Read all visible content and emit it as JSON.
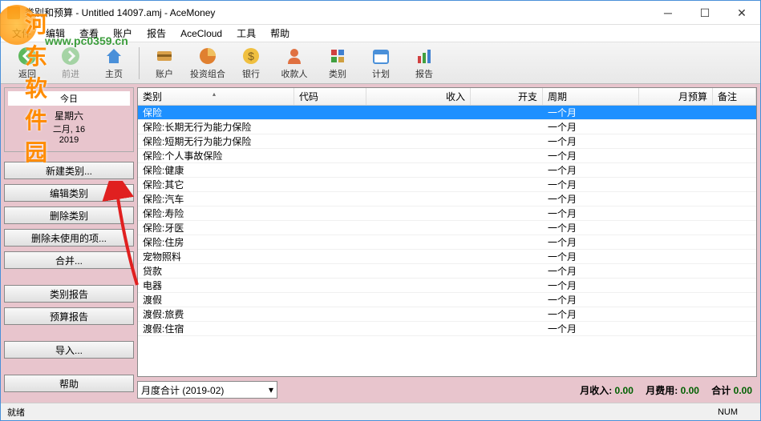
{
  "title": "类别和预算 - Untitled 14097.amj - AceMoney",
  "watermark": {
    "name": "河东软件园",
    "url": "www.pc0359.cn"
  },
  "menu": [
    "文件",
    "编辑",
    "查看",
    "账户",
    "报告",
    "AceCloud",
    "工具",
    "帮助"
  ],
  "toolbar": [
    {
      "label": "返回",
      "icon": "back"
    },
    {
      "label": "前进",
      "icon": "forward",
      "disabled": true
    },
    {
      "label": "主页",
      "icon": "home"
    },
    {
      "sep": true
    },
    {
      "label": "账户",
      "icon": "accounts"
    },
    {
      "label": "投资组合",
      "icon": "portfolio"
    },
    {
      "label": "银行",
      "icon": "bank"
    },
    {
      "label": "收款人",
      "icon": "payee"
    },
    {
      "label": "类别",
      "icon": "category"
    },
    {
      "label": "计划",
      "icon": "schedule"
    },
    {
      "label": "报告",
      "icon": "report"
    }
  ],
  "date": {
    "header": "今日",
    "day": "星期六",
    "month": "二月, 16",
    "year": "2019"
  },
  "sidebar_buttons": [
    "新建类别...",
    "编辑类别",
    "删除类别",
    "删除未使用的项...",
    "合并...",
    "",
    "类别报告",
    "预算报告",
    "",
    "导入...",
    "",
    "帮助"
  ],
  "columns": [
    {
      "label": "类别",
      "cls": "c-cat",
      "sort": true
    },
    {
      "label": "代码",
      "cls": "c-code"
    },
    {
      "label": "收入",
      "cls": "c-income",
      "right": true
    },
    {
      "label": "开支",
      "cls": "c-expense",
      "right": true
    },
    {
      "label": "周期",
      "cls": "c-period"
    },
    {
      "label": "月预算",
      "cls": "c-budget",
      "right": true
    },
    {
      "label": "备注",
      "cls": "c-note"
    }
  ],
  "rows": [
    {
      "cat": "保险",
      "period": "一个月",
      "selected": true
    },
    {
      "cat": "保险:长期无行为能力保险",
      "period": "一个月"
    },
    {
      "cat": "保险:短期无行为能力保险",
      "period": "一个月"
    },
    {
      "cat": "保险:个人事故保险",
      "period": "一个月"
    },
    {
      "cat": "保险:健康",
      "period": "一个月"
    },
    {
      "cat": "保险:其它",
      "period": "一个月"
    },
    {
      "cat": "保险:汽车",
      "period": "一个月"
    },
    {
      "cat": "保险:寿险",
      "period": "一个月"
    },
    {
      "cat": "保险:牙医",
      "period": "一个月"
    },
    {
      "cat": "保险:住房",
      "period": "一个月"
    },
    {
      "cat": "宠物照料",
      "period": "一个月"
    },
    {
      "cat": "贷款",
      "period": "一个月"
    },
    {
      "cat": "电器",
      "period": "一个月"
    },
    {
      "cat": "渡假",
      "period": "一个月"
    },
    {
      "cat": "渡假:旅费",
      "period": "一个月"
    },
    {
      "cat": "渡假:住宿",
      "period": "一个月"
    }
  ],
  "month_select": "月度合计 (2019-02)",
  "summary": {
    "income_lbl": "月收入:",
    "income_val": "0.00",
    "expense_lbl": "月费用:",
    "expense_val": "0.00",
    "total_lbl": "合计",
    "total_val": "0.00"
  },
  "status": {
    "left": "就绪",
    "right": "NUM"
  }
}
